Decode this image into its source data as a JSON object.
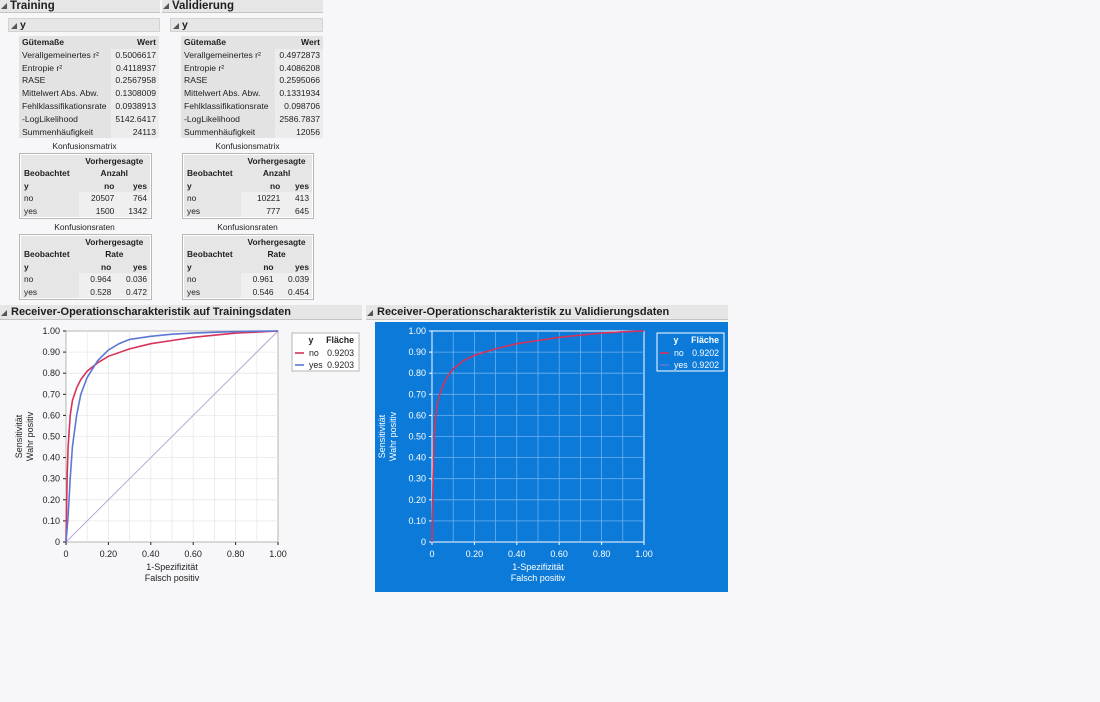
{
  "training": {
    "title": "Training",
    "sub_title": "y",
    "fit": {
      "header": [
        "Gütemaße",
        "Wert"
      ],
      "rows": [
        [
          "Verallgemeinertes r²",
          "0.5006617"
        ],
        [
          "Entropie r²",
          "0.4118937"
        ],
        [
          "RASE",
          "0.2567958"
        ],
        [
          "Mittelwert Abs. Abw.",
          "0.1308009"
        ],
        [
          "Fehlklassifikationsrate",
          "0.0938913"
        ],
        [
          "-LogLikelihood",
          "5142.6417"
        ],
        [
          "Summenhäufigkeit",
          "24113"
        ]
      ]
    },
    "confusion_matrix": {
      "caption": "Konfusionsmatrix",
      "head1": "Vorhergesagte",
      "head2_left": "Beobachtet",
      "head2_right": "Anzahl",
      "y": "y",
      "col_no": "no",
      "col_yes": "yes",
      "rows": [
        [
          "no",
          "20507",
          "764"
        ],
        [
          "yes",
          "1500",
          "1342"
        ]
      ]
    },
    "confusion_rates": {
      "caption": "Konfusionsraten",
      "head1": "Vorhergesagte",
      "head2_left": "Beobachtet",
      "head2_right": "Rate",
      "y": "y",
      "col_no": "no",
      "col_yes": "yes",
      "rows": [
        [
          "no",
          "0.964",
          "0.036"
        ],
        [
          "yes",
          "0.528",
          "0.472"
        ]
      ]
    }
  },
  "validation": {
    "title": "Validierung",
    "sub_title": "y",
    "fit": {
      "header": [
        "Gütemaße",
        "Wert"
      ],
      "rows": [
        [
          "Verallgemeinertes r²",
          "0.4972873"
        ],
        [
          "Entropie r²",
          "0.4086208"
        ],
        [
          "RASE",
          "0.2595066"
        ],
        [
          "Mittelwert Abs. Abw.",
          "0.1331934"
        ],
        [
          "Fehlklassifikationsrate",
          "0.098706"
        ],
        [
          "-LogLikelihood",
          "2586.7837"
        ],
        [
          "Summenhäufigkeit",
          "12056"
        ]
      ]
    },
    "confusion_matrix": {
      "caption": "Konfusionsmatrix",
      "head1": "Vorhergesagte",
      "head2_left": "Beobachtet",
      "head2_right": "Anzahl",
      "y": "y",
      "col_no": "no",
      "col_yes": "yes",
      "rows": [
        [
          "no",
          "10221",
          "413"
        ],
        [
          "yes",
          "777",
          "645"
        ]
      ]
    },
    "confusion_rates": {
      "caption": "Konfusionsraten",
      "head1": "Vorhergesagte",
      "head2_left": "Beobachtet",
      "head2_right": "Rate",
      "y": "y",
      "col_no": "no",
      "col_yes": "yes",
      "rows": [
        [
          "no",
          "0.961",
          "0.039"
        ],
        [
          "yes",
          "0.546",
          "0.454"
        ]
      ]
    }
  },
  "roc_train_title": "Receiver-Operationscharakteristik auf Trainingsdaten",
  "roc_valid_title": "Receiver-Operationscharakteristik zu Validierungsdaten",
  "colors": {
    "no": "#d6335a",
    "yes": "#5c78d4",
    "diagonal": "#b9a7d0",
    "selected_bg": "#0b7ad9"
  },
  "chart_data": [
    {
      "type": "line",
      "title": "Receiver-Operationscharakteristik auf Trainingsdaten",
      "xlabel": [
        "1-Spezifizität",
        "Falsch positiv"
      ],
      "ylabel": [
        "Sensitivität",
        "Wahr positiv"
      ],
      "xlim": [
        0,
        1
      ],
      "ylim": [
        0,
        1
      ],
      "x_ticks": [
        "0",
        "0.20",
        "0.40",
        "0.60",
        "0.80",
        "1.00"
      ],
      "y_ticks": [
        "0",
        "0.10",
        "0.20",
        "0.30",
        "0.40",
        "0.50",
        "0.60",
        "0.70",
        "0.80",
        "0.90",
        "1.00"
      ],
      "grid": true,
      "legend": {
        "title": "y",
        "col": "Fläche",
        "placement": "right"
      },
      "series": [
        {
          "name": "no",
          "area": "0.9203",
          "x": [
            0,
            0.005,
            0.01,
            0.02,
            0.03,
            0.05,
            0.07,
            0.1,
            0.15,
            0.2,
            0.3,
            0.4,
            0.5,
            0.6,
            0.7,
            0.8,
            0.9,
            1.0
          ],
          "y": [
            0,
            0.3,
            0.45,
            0.6,
            0.67,
            0.73,
            0.77,
            0.81,
            0.85,
            0.88,
            0.915,
            0.94,
            0.955,
            0.97,
            0.98,
            0.99,
            0.995,
            1.0
          ]
        },
        {
          "name": "yes",
          "area": "0.9203",
          "x": [
            0,
            0.01,
            0.02,
            0.03,
            0.05,
            0.07,
            0.1,
            0.15,
            0.2,
            0.25,
            0.3,
            0.4,
            0.5,
            0.6,
            0.7,
            0.8,
            0.9,
            1.0
          ],
          "y": [
            0,
            0.12,
            0.3,
            0.45,
            0.6,
            0.7,
            0.78,
            0.86,
            0.91,
            0.94,
            0.96,
            0.975,
            0.985,
            0.99,
            0.994,
            0.997,
            0.999,
            1.0
          ]
        }
      ]
    },
    {
      "type": "line",
      "title": "Receiver-Operationscharakteristik zu Validierungsdaten",
      "xlabel": [
        "1-Spezifizität",
        "Falsch positiv"
      ],
      "ylabel": [
        "Sensitivität",
        "Wahr positiv"
      ],
      "xlim": [
        0,
        1
      ],
      "ylim": [
        0,
        1
      ],
      "x_ticks": [
        "0",
        "0.20",
        "0.40",
        "0.60",
        "0.80",
        "1.00"
      ],
      "y_ticks": [
        "0",
        "0.10",
        "0.20",
        "0.30",
        "0.40",
        "0.50",
        "0.60",
        "0.70",
        "0.80",
        "0.90",
        "1.00"
      ],
      "grid": true,
      "legend": {
        "title": "y",
        "col": "Fläche",
        "placement": "right"
      },
      "series": [
        {
          "name": "no",
          "area": "0.9202",
          "x": [
            0,
            0.005,
            0.01,
            0.02,
            0.03,
            0.05,
            0.07,
            0.1,
            0.15,
            0.2,
            0.3,
            0.4,
            0.5,
            0.6,
            0.7,
            0.8,
            0.9,
            1.0
          ],
          "y": [
            0,
            0.32,
            0.5,
            0.62,
            0.68,
            0.74,
            0.78,
            0.82,
            0.86,
            0.885,
            0.915,
            0.94,
            0.955,
            0.97,
            0.98,
            0.99,
            0.996,
            1.0
          ]
        },
        {
          "name": "yes",
          "area": "0.9202",
          "x": [],
          "y": []
        }
      ]
    }
  ]
}
